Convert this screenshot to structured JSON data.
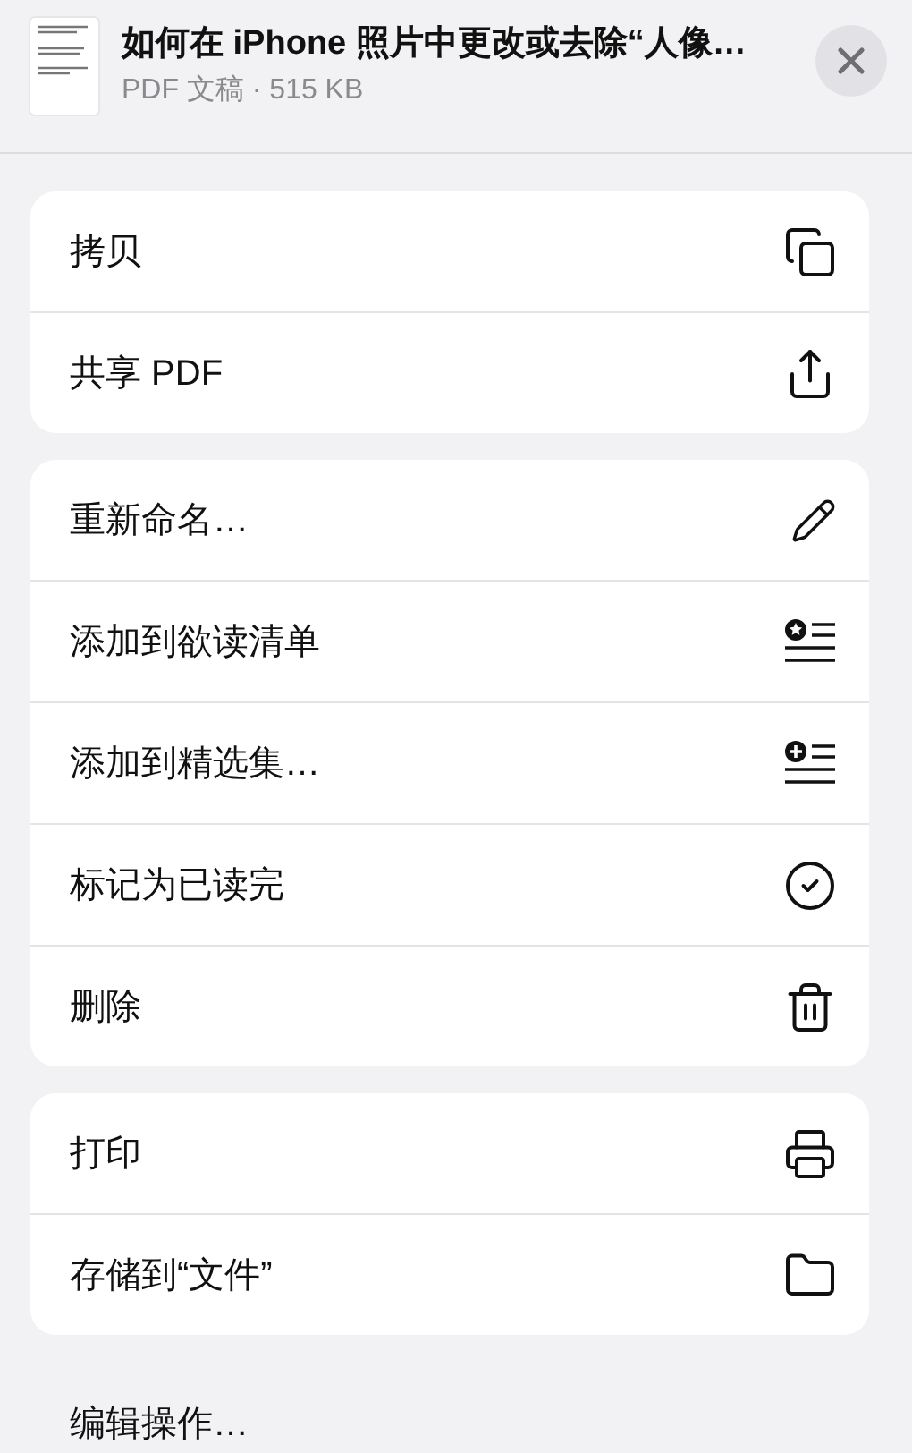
{
  "header": {
    "title": "如何在 iPhone 照片中更改或去除“人像…",
    "subtitle": "PDF 文稿 · 515 KB"
  },
  "groups": [
    {
      "items": [
        {
          "label": "拷贝",
          "kind": "copy"
        },
        {
          "label": "共享 PDF",
          "kind": "share"
        }
      ]
    },
    {
      "items": [
        {
          "label": "重新命名…",
          "kind": "rename"
        },
        {
          "label": "添加到欲读清单",
          "kind": "reading-list"
        },
        {
          "label": "添加到精选集…",
          "kind": "collection"
        },
        {
          "label": "标记为已读完",
          "kind": "done"
        },
        {
          "label": "删除",
          "kind": "delete"
        }
      ]
    },
    {
      "items": [
        {
          "label": "打印",
          "kind": "print"
        },
        {
          "label": "存储到“文件”",
          "kind": "files"
        }
      ]
    }
  ],
  "footer_action": "编辑操作…"
}
